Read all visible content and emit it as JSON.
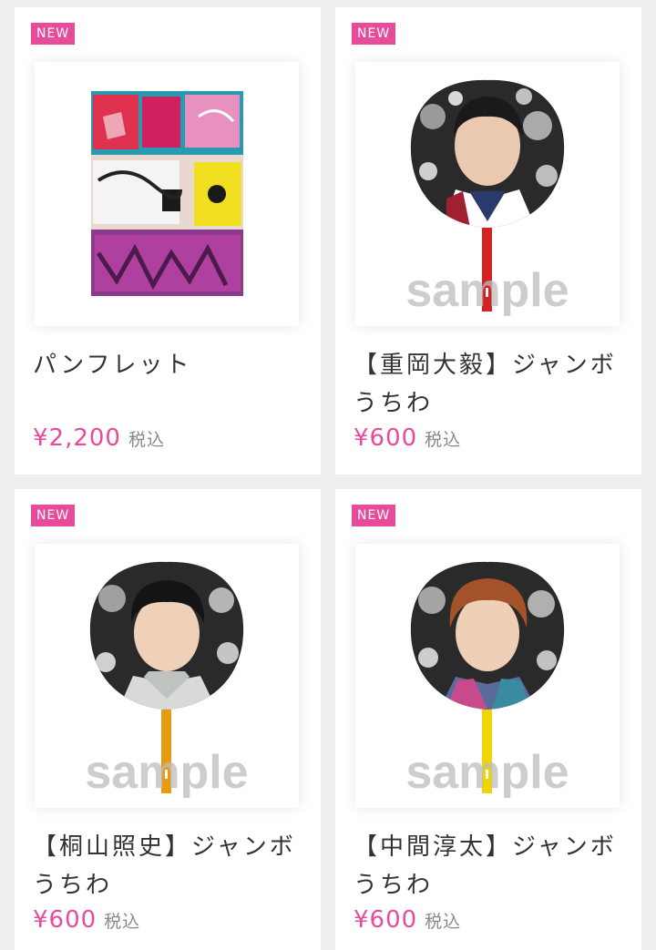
{
  "products": [
    {
      "badge": "NEW",
      "name": "パンフレット",
      "price": "¥2,200",
      "tax_label": "税込",
      "image_icon": "pamphlet-graffiti-cover"
    },
    {
      "badge": "NEW",
      "name": "【重岡大毅】ジャンボうちわ",
      "price": "¥600",
      "tax_label": "税込",
      "image_icon": "jumbo-uchiwa-fan",
      "watermark": "sample",
      "handle_color": "#d42222"
    },
    {
      "badge": "NEW",
      "name": "【桐山照史】ジャンボうちわ",
      "price": "¥600",
      "tax_label": "税込",
      "image_icon": "jumbo-uchiwa-fan",
      "watermark": "sample",
      "handle_color": "#e89a10"
    },
    {
      "badge": "NEW",
      "name": "【中間淳太】ジャンボうちわ",
      "price": "¥600",
      "tax_label": "税込",
      "image_icon": "jumbo-uchiwa-fan",
      "watermark": "sample",
      "handle_color": "#f2d400"
    }
  ],
  "colors": {
    "accent": "#e84a9c",
    "background": "#eeeeee"
  }
}
